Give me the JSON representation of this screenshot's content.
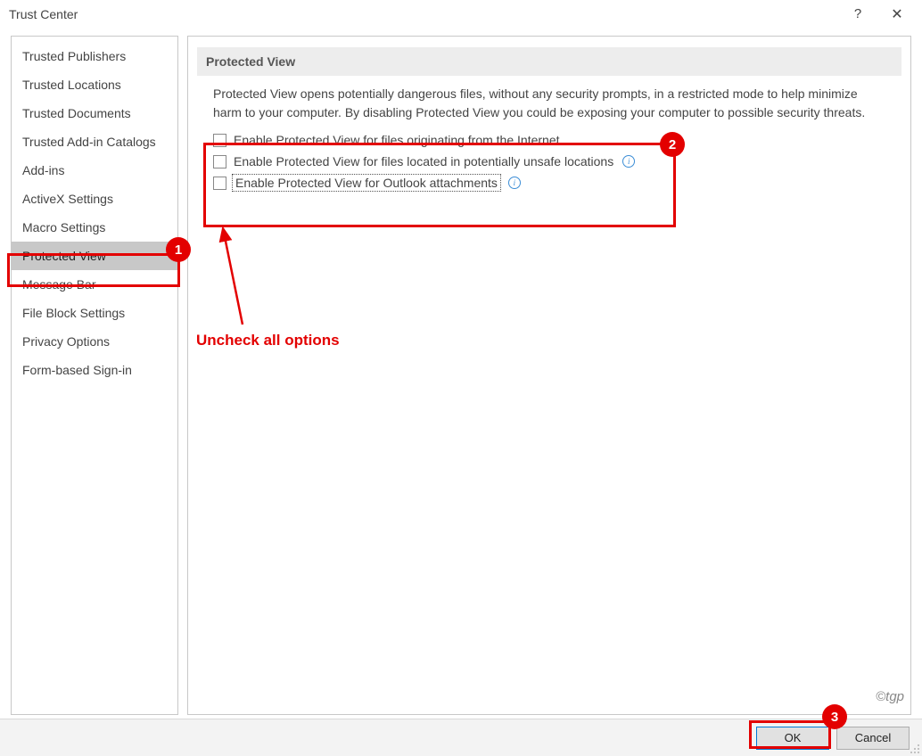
{
  "window": {
    "title": "Trust Center"
  },
  "sidebar": {
    "items": [
      {
        "label": "Trusted Publishers"
      },
      {
        "label": "Trusted Locations"
      },
      {
        "label": "Trusted Documents"
      },
      {
        "label": "Trusted Add-in Catalogs"
      },
      {
        "label": "Add-ins"
      },
      {
        "label": "ActiveX Settings"
      },
      {
        "label": "Macro Settings"
      },
      {
        "label": "Protected View",
        "selected": true
      },
      {
        "label": "Message Bar"
      },
      {
        "label": "File Block Settings"
      },
      {
        "label": "Privacy Options"
      },
      {
        "label": "Form-based Sign-in"
      }
    ]
  },
  "panel": {
    "heading": "Protected View",
    "description": "Protected View opens potentially dangerous files, without any security prompts, in a restricted mode to help minimize harm to your computer. By disabling Protected View you could be exposing your computer to possible security threats.",
    "checkboxes": [
      {
        "label": "Enable Protected View for files originating from the Internet",
        "checked": false,
        "info": false
      },
      {
        "label": "Enable Protected View for files located in potentially unsafe locations",
        "checked": false,
        "info": true
      },
      {
        "label": "Enable Protected View for Outlook attachments",
        "checked": false,
        "info": true,
        "focused": true
      }
    ]
  },
  "footer": {
    "ok_label": "OK",
    "cancel_label": "Cancel"
  },
  "annotations": {
    "badge1": "1",
    "badge2": "2",
    "badge3": "3",
    "callout": "Uncheck all options"
  },
  "watermark": "©tgp"
}
